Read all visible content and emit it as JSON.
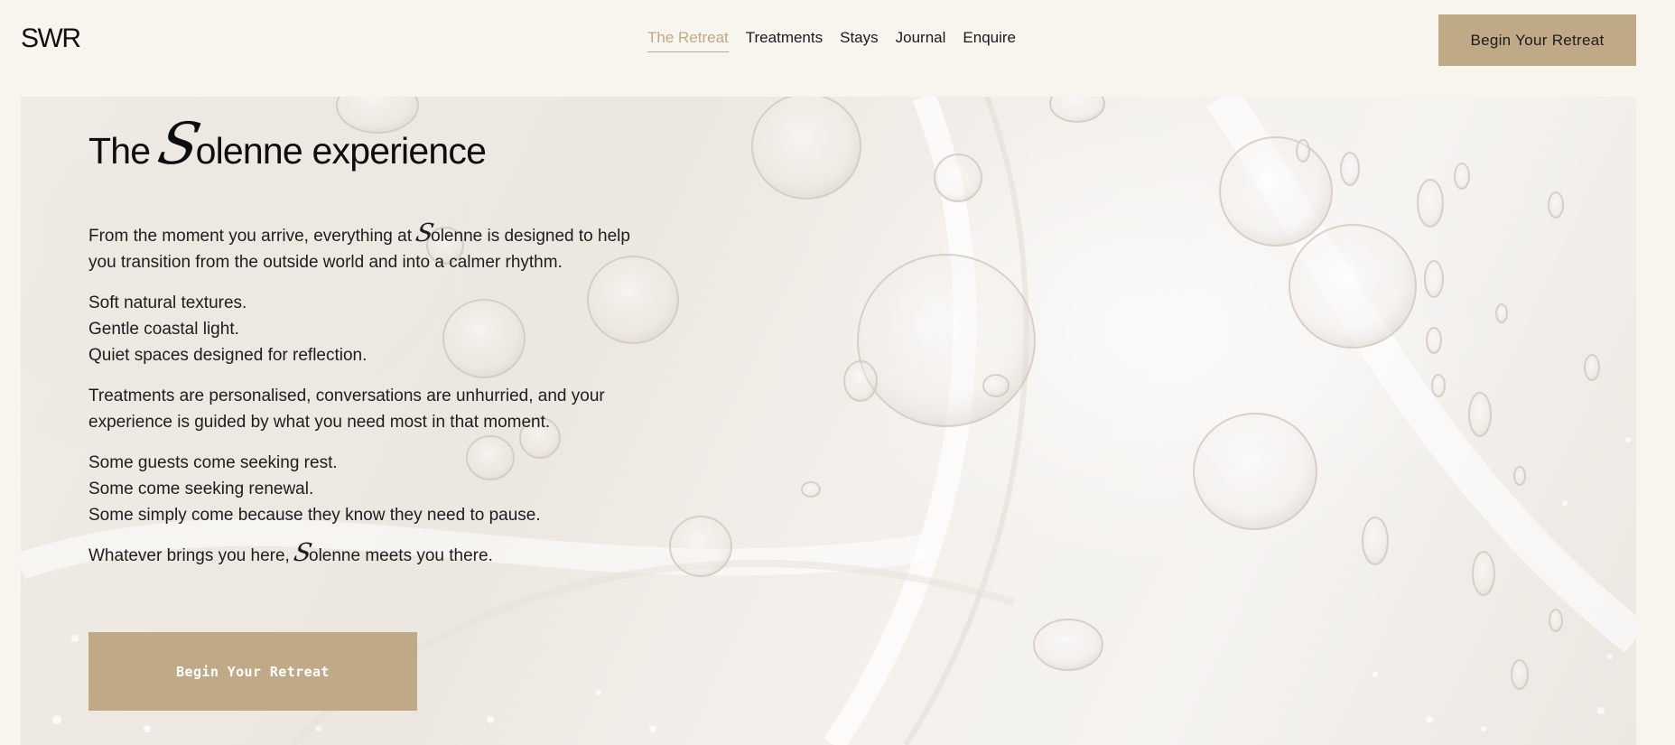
{
  "header": {
    "logo": "SWR",
    "nav": [
      {
        "label": "The Retreat",
        "active": true
      },
      {
        "label": "Treatments",
        "active": false
      },
      {
        "label": "Stays",
        "active": false
      },
      {
        "label": "Journal",
        "active": false
      },
      {
        "label": "Enquire",
        "active": false
      }
    ],
    "cta_label": "Begin Your Retreat"
  },
  "hero": {
    "title_prefix": "The ",
    "title_script_letter": "S",
    "title_suffix": "olenne experience",
    "p1_before": "From the moment you arrive, everything at ",
    "p1_script_letter": "S",
    "p1_after_line1": "olenne is designed to help",
    "p1_line2": "you transition from the outside world and into a calmer rhythm.",
    "p2_lines": [
      "Soft natural textures.",
      "Gentle coastal light.",
      "Quiet spaces designed for reflection."
    ],
    "p3_line1": "Treatments are personalised, conversations are unhurried, and your",
    "p3_line2": "experience is guided by what you need most in that moment.",
    "p4_lines": [
      "Some guests come seeking rest.",
      "Some come seeking renewal.",
      "Some simply come because they know they need to pause."
    ],
    "p5_before": "Whatever brings you here, ",
    "p5_script_letter": "S",
    "p5_after": "olenne meets you there.",
    "cta_label": "Begin Your Retreat"
  },
  "colors": {
    "accent": "#c0a987",
    "active_nav": "#bfa888",
    "header_bg": "#f8f5ef"
  }
}
